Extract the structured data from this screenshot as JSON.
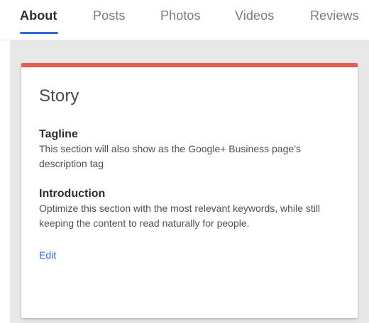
{
  "tabs": {
    "items": [
      {
        "label": "About",
        "active": true
      },
      {
        "label": "Posts",
        "active": false
      },
      {
        "label": "Photos",
        "active": false
      },
      {
        "label": "Videos",
        "active": false
      },
      {
        "label": "Reviews",
        "active": false
      }
    ]
  },
  "card": {
    "title": "Story",
    "sections": [
      {
        "title": "Tagline",
        "text": "This section will also show as the Google+ Business page’s description tag"
      },
      {
        "title": "Introduction",
        "text": "Optimize this section with the most relevant keywords, while still keeping the content to read naturally for people."
      }
    ],
    "edit_label": "Edit"
  },
  "colors": {
    "accent_bar": "#e35d52",
    "tab_underline": "#3367d6",
    "link": "#3367d6",
    "background": "#e8e8e8"
  }
}
